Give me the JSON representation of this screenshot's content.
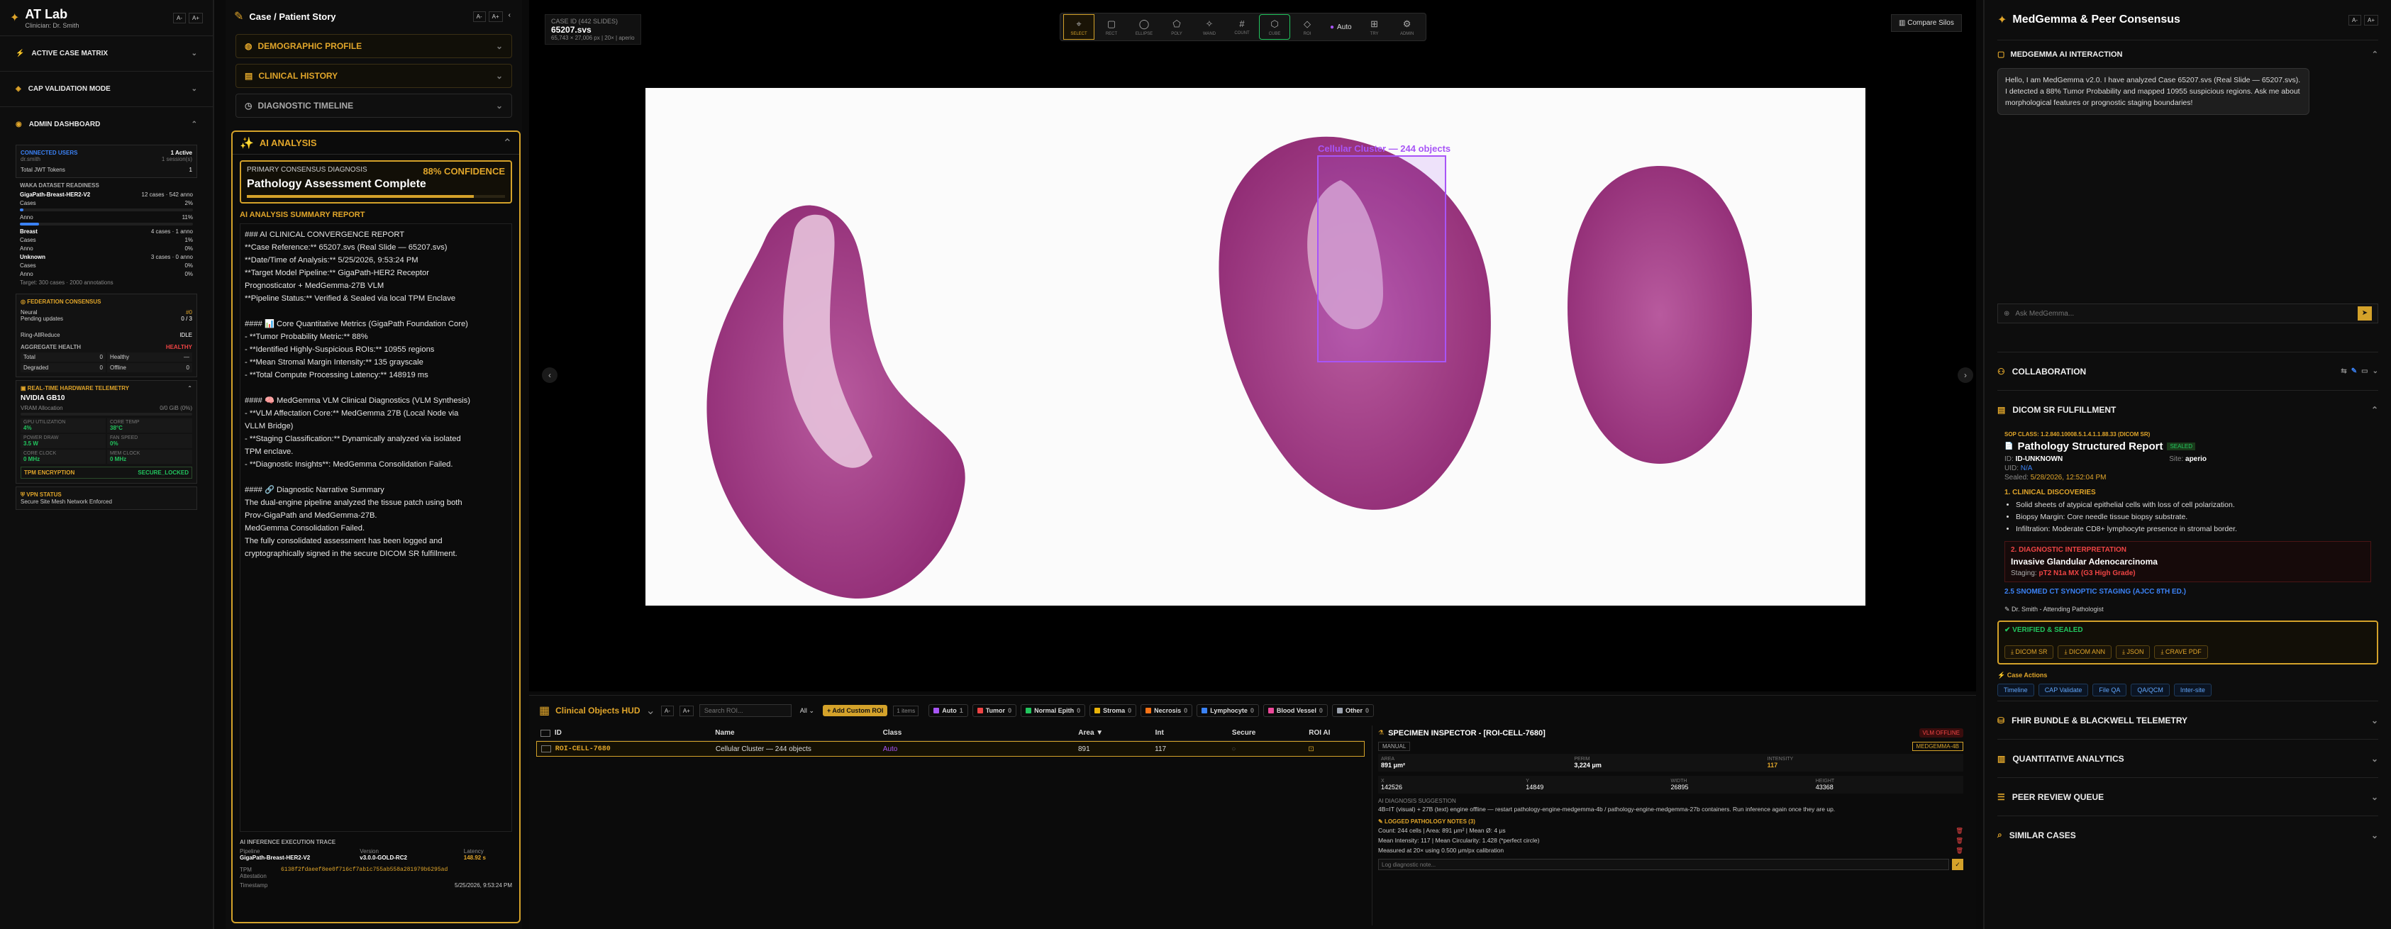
{
  "app": {
    "title": "AT Lab",
    "clinician": "Clinician: Dr. Smith",
    "font_small": "A-",
    "font_large": "A+"
  },
  "left": {
    "sections": [
      "ACTIVE CASE MATRIX",
      "CAP VALIDATION MODE",
      "ADMIN DASHBOARD"
    ],
    "connected_users": {
      "label": "CONNECTED USERS",
      "value": "1 Active",
      "sub_left": "dr.smith",
      "sub_right": "1 session(s)",
      "tokens_label": "Total JWT Tokens",
      "tokens": "1"
    },
    "waka": {
      "title": "WAKA DATASET READINESS",
      "model": "GigaPath-Breast-HER2-V2",
      "model_stat": "12 cases · 542 anno",
      "rows": [
        [
          "Cases",
          "2%"
        ],
        [
          "Anno",
          "11%"
        ]
      ],
      "breast": {
        "name": "Breast",
        "stat": "4 cases · 1 anno",
        "rows": [
          [
            "Cases",
            "1%"
          ],
          [
            "Anno",
            "0%"
          ]
        ]
      },
      "unknown": {
        "name": "Unknown",
        "stat": "3 cases · 0 anno",
        "rows": [
          [
            "Cases",
            "0%"
          ],
          [
            "Anno",
            "0%"
          ]
        ]
      },
      "target": "Target: 300 cases · 2000 annotations"
    },
    "federation": {
      "title": "FEDERATION CONSENSUS",
      "rows": [
        [
          "Neural",
          "#0"
        ],
        [
          "Pending updates",
          "0 / 3"
        ],
        [
          "Ring-AllReduce",
          "IDLE"
        ]
      ],
      "agg_label": "AGGREGATE HEALTH",
      "agg_value": "HEALTHY",
      "cells": [
        [
          "Total",
          "0"
        ],
        [
          "Healthy",
          "—"
        ],
        [
          "Degraded",
          "0"
        ],
        [
          "Offline",
          "0"
        ]
      ]
    },
    "telemetry": {
      "title": "REAL-TIME HARDWARE TELEMETRY",
      "gpu": "NVIDIA GB10",
      "vram_label": "VRAM Allocation",
      "vram_val": "0/0 GiB (0%)",
      "cells": [
        [
          "GPU UTILIZATION",
          "4%"
        ],
        [
          "CORE TEMP",
          "38°C"
        ],
        [
          "POWER DRAW",
          "3.5 W"
        ],
        [
          "FAN SPEED",
          "0%"
        ],
        [
          "CORE CLOCK",
          "0 MHz"
        ],
        [
          "MEM CLOCK",
          "0 MHz"
        ]
      ],
      "tpm_label": "TPM ENCRYPTION",
      "tpm_value": "SECURE_LOCKED"
    },
    "vpn": {
      "title": "VPN STATUS",
      "text": "Secure Site Mesh Network Enforced"
    }
  },
  "story": {
    "title": "Case / Patient Story",
    "accordions": [
      "DEMOGRAPHIC PROFILE",
      "CLINICAL HISTORY",
      "DIAGNOSTIC TIMELINE"
    ],
    "ai_title": "AI ANALYSIS",
    "primary_label": "PRIMARY CONSENSUS DIAGNOSIS",
    "confidence": "88% CONFIDENCE",
    "headline": "Pathology Assessment Complete",
    "report_title": "AI ANALYSIS SUMMARY REPORT",
    "report_lines": [
      "### AI CLINICAL CONVERGENCE REPORT",
      "**Case Reference:** 65207.svs (Real Slide — 65207.svs)",
      "**Date/Time of Analysis:** 5/25/2026, 9:53:24 PM",
      "**Target Model Pipeline:** GigaPath-HER2 Receptor",
      "Prognosticator + MedGemma-27B VLM",
      "**Pipeline Status:** Verified & Sealed via local TPM Enclave",
      "",
      "#### 📊 Core Quantitative Metrics (GigaPath Foundation Core)",
      "- **Tumor Probability Metric:** 88%",
      "- **Identified Highly-Suspicious ROIs:** 10955 regions",
      "- **Mean Stromal Margin Intensity:** 135 grayscale",
      "- **Total Compute Processing Latency:** 148919 ms",
      "",
      "#### 🧠 MedGemma VLM Clinical Diagnostics (VLM Synthesis)",
      "- **VLM Affectation Core:** MedGemma 27B (Local Node via",
      "VLLM Bridge)",
      "- **Staging Classification:** Dynamically analyzed via isolated",
      "TPM enclave.",
      "- **Diagnostic Insights**: MedGemma Consolidation Failed.",
      "",
      "#### 🔗 Diagnostic Narrative Summary",
      "The dual-engine pipeline analyzed the tissue patch using both",
      "Prov-GigaPath and MedGemma-27B.",
      "MedGemma Consolidation Failed.",
      "The fully consolidated assessment has been logged and",
      "cryptographically signed in the secure DICOM SR fulfillment."
    ],
    "trace_title": "AI INFERENCE EXECUTION TRACE",
    "trace": {
      "pipeline_label": "Pipeline",
      "pipeline": "GigaPath-Breast-HER2-V2",
      "version_label": "Version",
      "version": "v3.0.0-GOLD-RC2",
      "latency_label": "Latency",
      "latency": "148.92 s",
      "tpm_label": "TPM Attestation",
      "tpm": "6138f2fdaeef8ee0f716cf7ab1c755ab558a281979b6295ad",
      "ts_label": "Timestamp",
      "ts": "5/25/2026, 9:53:24 PM"
    }
  },
  "viewer": {
    "case_label": "CASE ID (442 SLIDES)",
    "case_id": "65207.svs",
    "case_dims": "65,743 × 27,006 px | 20× | aperio",
    "tools": [
      "SELECT",
      "RECT",
      "ELLIPSE",
      "POLY",
      "WAND",
      "COUNT",
      "CUBE",
      "ROI",
      "AUTO",
      "TRY",
      "ADMIN"
    ],
    "auto_label": "Auto",
    "compare": "Compare Silos",
    "roi_label": "Cellular Cluster — 244 objects"
  },
  "hud": {
    "title": "Clinical Objects HUD",
    "search_ph": "Search ROI...",
    "filter": "All",
    "add_btn": "+ Add Custom ROI",
    "count": "1 items",
    "chips": [
      [
        "Auto",
        "1"
      ],
      [
        "Tumor",
        "0"
      ],
      [
        "Normal Epith",
        "0"
      ],
      [
        "Stroma",
        "0"
      ],
      [
        "Necrosis",
        "0"
      ],
      [
        "Lymphocyte",
        "0"
      ],
      [
        "Blood Vessel",
        "0"
      ],
      [
        "Other",
        "0"
      ]
    ],
    "colors": [
      "#a855f7",
      "#ef4444",
      "#22c55e",
      "#eab308",
      "#f97316",
      "#3b82f6",
      "#ec4899",
      "#9ca3af"
    ],
    "cols": [
      "ID",
      "Name",
      "Class",
      "Area ▼",
      "Int",
      "Secure",
      "ROI AI"
    ],
    "row": {
      "id": "ROI-CELL-7680",
      "name": "Cellular Cluster — 244 objects",
      "class": "Auto",
      "area": "891",
      "int": "117"
    },
    "inspector": {
      "title": "SPECIMEN INSPECTOR - [ROI-CELL-7680]",
      "vlm": "VLM OFFLINE",
      "manual": "MANUAL",
      "medgemma": "MEDGEMMA-4B",
      "area_label": "AREA",
      "area": "891 μm²",
      "perim_label": "PERIM",
      "perim": "3,224 μm",
      "int_label": "INTENSITY",
      "int": "117",
      "x_label": "X",
      "x": "142526",
      "y_label": "Y",
      "y": "14849",
      "w_label": "WIDTH",
      "w": "26895",
      "h_label": "HEIGHT",
      "h": "43368",
      "sugg_title": "AI DIAGNOSIS SUGGESTION",
      "sugg": "4B=IT (visual) + 27B (text) engine offline — restart pathology-engine-medgemma-4b / pathology-engine-medgemma-27b containers. Run inference again once they are up.",
      "notes_title": "LOGGED PATHOLOGY NOTES (3)",
      "notes": [
        "Count: 244 cells | Area: 891 μm² | Mean Ø: 4 μs",
        "Mean Intensity: 117 | Mean Circularity: 1.428 (*perfect circle)",
        "Measured at 20× using 0.500 μm/px calibration"
      ],
      "log_ph": "Log diagnostic note..."
    }
  },
  "right": {
    "title": "MedGemma & Peer Consensus",
    "interaction": "MEDGEMMA AI INTERACTION",
    "message": "Hello, I am MedGemma v2.0. I have analyzed Case 65207.svs (Real Slide — 65207.svs). I detected a 88% Tumor Probability and mapped 10955 suspicious regions. Ask me about morphological features or prognostic staging boundaries!",
    "ask_ph": "Ask MedGemma...",
    "collab": "COLLABORATION",
    "dicom_title": "DICOM SR FULFILLMENT",
    "sop": "SOP CLASS: 1.2.840.10008.5.1.4.1.1.88.33 (DICOM SR)",
    "report_title": "Pathology Structured Report",
    "sealed": "SEALED",
    "id_label": "ID:",
    "id": "ID-UNKNOWN",
    "site_label": "Site:",
    "site": "aperio",
    "uid_label": "UID:",
    "uid": "N/A",
    "sealed_label": "Sealed:",
    "sealed_ts": "5/28/2026, 12:52:04 PM",
    "disc_title": "1. CLINICAL DISCOVERIES",
    "disc": [
      "Solid sheets of atypical epithelial cells with loss of cell polarization.",
      "Biopsy Margin: Core needle tissue biopsy substrate.",
      "Infiltration: Moderate CD8+ lymphocyte presence in stromal border."
    ],
    "interp_title": "2. DIAGNOSTIC INTERPRETATION",
    "interp": "Invasive Glandular Adenocarcinoma",
    "staging_label": "Staging:",
    "staging": "pT2 N1a MX (G3 High Grade)",
    "snomed": "2.5 SNOMED CT SYNOPTIC STAGING (AJCC 8TH ED.)",
    "signer": "Dr. Smith - Attending Pathologist",
    "verified": "VERIFIED & SEALED",
    "exports": [
      "DICOM SR",
      "DICOM ANN",
      "JSON",
      "CRAVE PDF"
    ],
    "case_actions": "Case Actions",
    "actions": [
      "Timeline",
      "CAP Validate",
      "File QA",
      "QA/QCM",
      "Inter-site"
    ],
    "sections": [
      "FHIR BUNDLE & BLACKWELL TELEMETRY",
      "QUANTITATIVE ANALYTICS",
      "PEER REVIEW QUEUE",
      "SIMILAR CASES"
    ]
  }
}
